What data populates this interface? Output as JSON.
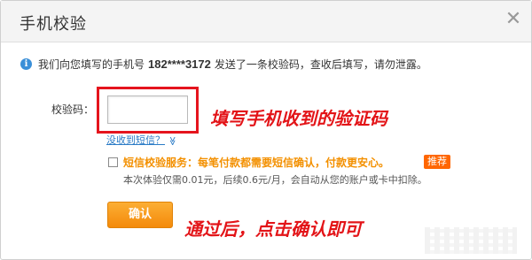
{
  "dialog": {
    "title": "手机校验",
    "close_glyph": "✕"
  },
  "info": {
    "icon_glyph": "i",
    "prefix": "我们向您填写的手机号",
    "phone": "182****3172",
    "suffix": "发送了一条校验码，查收后填写，请勿泄露。"
  },
  "form": {
    "code_label": "校验码：",
    "code_value": "",
    "resend_label": "没收到短信？",
    "resend_chevron": "≫"
  },
  "sms_service": {
    "title": "短信校验服务：每笔付款都需要短信确认，付款更安心。",
    "badge": "推荐",
    "description": "本次体验仅需0.01元，后续0.6元/月，会自动从您的账户或卡中扣除。",
    "checked": false
  },
  "buttons": {
    "confirm_label": "确认"
  },
  "annotations": {
    "input_hint": "填写手机收到的验证码",
    "confirm_hint": "通过后，点击确认即可"
  },
  "colors": {
    "annotation_red": "#e31418",
    "link_blue": "#2b7bc6",
    "accent_orange": "#f39000",
    "button_orange": "#f48a0a",
    "badge_orange": "#ff6600",
    "info_blue": "#3a8fd8"
  }
}
